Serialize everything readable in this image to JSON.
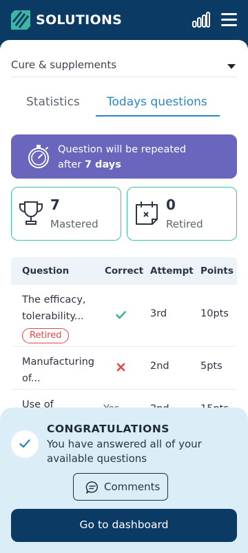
{
  "header": {
    "brand": "SOLUTIONS",
    "icons": [
      "logo-icon",
      "signal-icon",
      "menu-icon"
    ]
  },
  "category_select": {
    "value": "Cure & supplements"
  },
  "tabs": [
    {
      "label": "Statistics",
      "active": false
    },
    {
      "label": "Todays questions",
      "active": true
    }
  ],
  "banner": {
    "text_line1": "Question will be repeated",
    "text_prefix": "after ",
    "text_bold": "7 days",
    "icon": "stopwatch-icon"
  },
  "stats": {
    "mastered": {
      "value": "7",
      "label": "Mastered",
      "icon": "trophy-icon"
    },
    "retired": {
      "value": "0",
      "label": "Retired",
      "icon": "calendar-x-icon"
    }
  },
  "table": {
    "headers": [
      "Question",
      "Correct",
      "Attempt",
      "Points"
    ],
    "rows": [
      {
        "question": "The efficacy, tolerability...",
        "correct": "check",
        "attempt": "3rd",
        "points": "10pts",
        "badge": "Retired"
      },
      {
        "question": "Manufacturing of...",
        "correct": "cross",
        "attempt": "2nd",
        "points": "5pts"
      },
      {
        "question": "Use of",
        "correct": "Yes",
        "attempt": "2nd",
        "points": "15pts"
      }
    ]
  },
  "congrats": {
    "title": "CONGRATULATIONS",
    "message": "You have answered all of your available questions",
    "comments_label": "Comments",
    "dashboard_label": "Go to dashboard"
  },
  "colors": {
    "navy": "#0b3a64",
    "accent_blue": "#2a86c6",
    "banner_purple": "#6a65bd",
    "teal": "#35c3a5",
    "error_red": "#e24545",
    "congrats_bg": "#dbeef8"
  }
}
